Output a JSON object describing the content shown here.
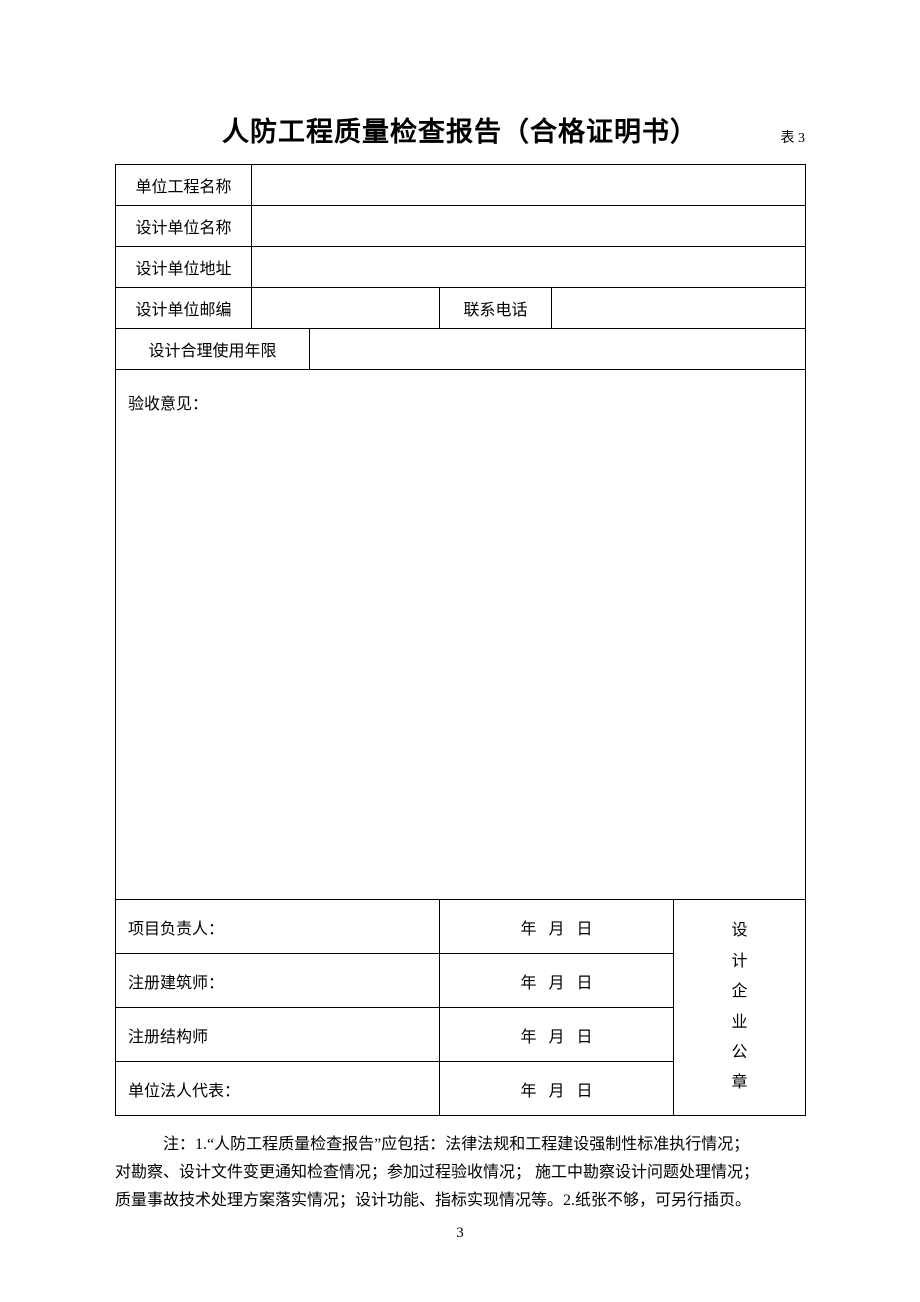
{
  "title": "人防工程质量检查报告（合格证明书）",
  "table_no": "表 3",
  "rows": {
    "unit_project_name_label": "单位工程名称",
    "design_unit_name_label": "设计单位名称",
    "design_unit_addr_label": "设计单位地址",
    "design_unit_zip_label": "设计单位邮编",
    "contact_phone_label": "联系电话",
    "design_life_label": "设计合理使用年限"
  },
  "opinion_label": "验收意见：",
  "signatures": {
    "project_lead": "项目负责人：",
    "reg_architect": "注册建筑师：",
    "reg_structural": "注册结构师",
    "legal_rep": "单位法人代表："
  },
  "date": {
    "year": "年",
    "month": "月",
    "day": "日"
  },
  "stamp": [
    "设",
    "计",
    "企",
    "业",
    "公",
    "章"
  ],
  "note_line1": "注：1.“人防工程质量检查报告”应包括：法律法规和工程建设强制性标准执行情况；",
  "note_line2": "对勘察、设计文件变更通知检查情况；参加过程验收情况；  施工中勘察设计问题处理情况；",
  "note_line3": "质量事故技术处理方案落实情况；设计功能、指标实现情况等。2.纸张不够，可另行插页。",
  "page_number": "3"
}
